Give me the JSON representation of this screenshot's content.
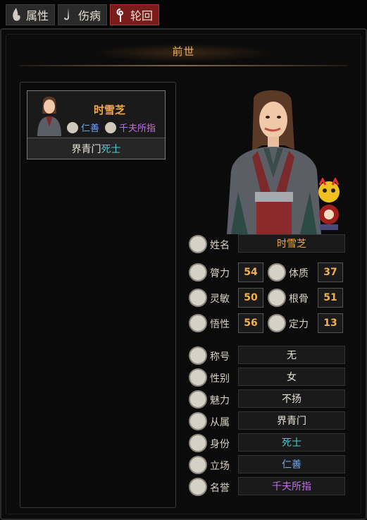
{
  "tabs": [
    {
      "label": "属性",
      "icon": "flame-icon",
      "active": false
    },
    {
      "label": "伤病",
      "icon": "needle-icon",
      "active": false
    },
    {
      "label": "轮回",
      "icon": "spiral-icon",
      "active": true
    }
  ],
  "header": {
    "title": "前世"
  },
  "card": {
    "name": "时雪芝",
    "stance_tag": "仁善",
    "fame_tag": "千夫所指",
    "faction": "界青门",
    "identity": "死士"
  },
  "profile": {
    "name_label": "姓名",
    "name_value": "时雪芝",
    "stats": {
      "strength_label": "膂力",
      "strength": "54",
      "constitution_label": "体质",
      "constitution": "37",
      "agility_label": "灵敏",
      "agility": "50",
      "bone_label": "根骨",
      "bone": "51",
      "insight_label": "悟性",
      "insight": "56",
      "focus_label": "定力",
      "focus": "13"
    },
    "title_label": "称号",
    "title_value": "无",
    "gender_label": "性别",
    "gender_value": "女",
    "charm_label": "魅力",
    "charm_value": "不扬",
    "affiliation_label": "从属",
    "affiliation_value": "界青门",
    "identity_label": "身份",
    "identity_value": "死士",
    "stance_label": "立场",
    "stance_value": "仁善",
    "reputation_label": "名誉",
    "reputation_value": "千夫所指"
  },
  "colors": {
    "accent_orange": "#f0a848",
    "stance_blue": "#6fa8e8",
    "fame_purple": "#c06ee8",
    "identity_cyan": "#56c8c8",
    "active_tab": "#7a1c1c"
  }
}
